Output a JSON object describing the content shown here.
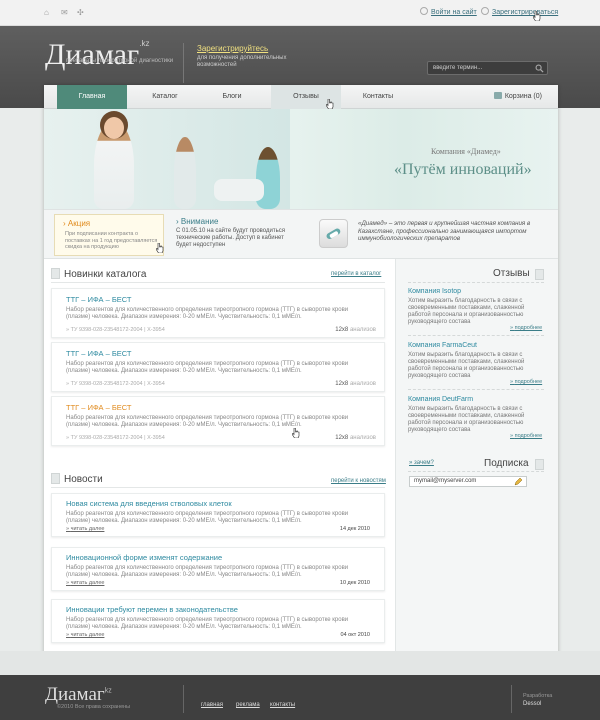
{
  "topbar": {
    "login": "Войти на сайт",
    "register": "Зарегистрироваться"
  },
  "header": {
    "logo": "Диамаг",
    "logo_tld": ".kz",
    "tagline": "препараты лабораторной диагностики",
    "register_link": "Зарегистрируйтесь",
    "register_text": "для получения дополнительных возможностей",
    "search_placeholder": "введите термин..."
  },
  "nav": {
    "items": [
      "Главная",
      "Каталог",
      "Блоги",
      "Отзывы",
      "Контакты"
    ],
    "cart": "Корзина (0)"
  },
  "banner": {
    "company": "Компания «Диамед»",
    "slogan": "«Путём инноваций»"
  },
  "strip": {
    "promo_title": "Акция",
    "promo_text": "При подписании контракта о поставках на 1 год предоставляется скидка на продукцию",
    "attention_title": "Внимание",
    "attention_text": "С 01.05.10 на сайте будут проводиться технические работы. Доступ в кабинет будет недоступен",
    "about": "«Диамед» – это первая и крупнейшая частная компания в Казахстане, профессионально занимающаяся импортом иммунобиологических препаратов"
  },
  "catalog": {
    "heading": "Новинки каталога",
    "link": "перейти в каталог",
    "cards": [
      {
        "title": "ТТГ – ИФА – БЕСТ",
        "desc": "Набор реагентов для количественного определения тиреотропного гормона (ТТГ) в сыворотке крови (плазме) человека. Диапазон измерения: 0-20 мМЕ/л. Чувствительность: 0,1 мМЕ/л.",
        "meta": "» ТУ 9398-028-23548172-2004   |   Х-3954",
        "count": "12х8",
        "unit": "анализов"
      },
      {
        "title": "ТТГ – ИФА – БЕСТ",
        "desc": "Набор реагентов для количественного определения тиреотропного гормона (ТТГ) в сыворотке крови (плазме) человека. Диапазон измерения: 0-20 мМЕ/л. Чувствительность: 0,1 мМЕ/л.",
        "meta": "» ТУ 9398-028-23548172-2004   |   Х-3954",
        "count": "12х8",
        "unit": "анализов"
      },
      {
        "title": "ТТГ – ИФА – БЕСТ",
        "desc": "Набор реагентов для количественного определения тиреотропного гормона (ТТГ) в сыворотке крови (плазме) человека. Диапазон измерения: 0-20 мМЕ/л. Чувствительность: 0,1 мМЕ/л.",
        "meta": "» ТУ 9398-028-23548172-2004   |   Х-3954",
        "count": "12х8",
        "unit": "анализов"
      }
    ]
  },
  "news": {
    "heading": "Новости",
    "link": "перейти к новостям",
    "items": [
      {
        "title": "Новая система для введения стволовых клеток",
        "desc": "Набор реагентов для количественного определения тиреотропного гормона (ТТГ) в сыворотке крови (плазме) человека. Диапазон измерения: 0-20 мМЕ/л. Чувствительность: 0,1 мМЕ/л.",
        "more": "читать далее",
        "date": "14 дек 2010"
      },
      {
        "title": "Инновационной форме изменят содержание",
        "desc": "Набор реагентов для количественного определения тиреотропного гормона (ТТГ) в сыворотке крови (плазме) человека. Диапазон измерения: 0-20 мМЕ/л. Чувствительность: 0,1 мМЕ/л.",
        "more": "читать далее",
        "date": "10 дек 2010"
      },
      {
        "title": "Инновации требуют перемен в законодательстве",
        "desc": "Набор реагентов для количественного определения тиреотропного гормона (ТТГ) в сыворотке крови (плазме) человека. Диапазон измерения: 0-20 мМЕ/л. Чувствительность: 0,1 мМЕ/л.",
        "more": "читать далее",
        "date": "04 окт 2010"
      }
    ]
  },
  "reviews": {
    "heading": "Отзывы",
    "items": [
      {
        "name": "Компания Isotop",
        "text": "Хотим выразить благодарность в связи с своевременными поставками, слаженной работой персонала и организованностью руководящего состава",
        "more": "подробнее"
      },
      {
        "name": "Компания FarmaCeut",
        "text": "Хотим выразить благодарность в связи с своевременными поставками, слаженной работой персонала и организованностью руководящего состава",
        "more": "подробнее"
      },
      {
        "name": "Компания DeutFarm",
        "text": "Хотим выразить благодарность в связи с своевременными поставками, слаженной работой персонала и организованностью руководящего состава",
        "more": "подробнее"
      }
    ]
  },
  "subscribe": {
    "heading": "Подписка",
    "link": "зачем?",
    "value": "mymail@myserver.com"
  },
  "footer": {
    "logo": "Диамаг",
    "logo_tld": "kz",
    "copy": "©2010 Все права сохранены",
    "links": [
      "главная",
      "реклама",
      "контакты"
    ],
    "dev_label": "Разработка",
    "dev_name": "Dessol"
  },
  "colors": {
    "accent": "#2e8aa0",
    "active_nav": "#4f8a7a",
    "highlight": "#e08a1c",
    "header_bg": "#4f4f4f"
  }
}
